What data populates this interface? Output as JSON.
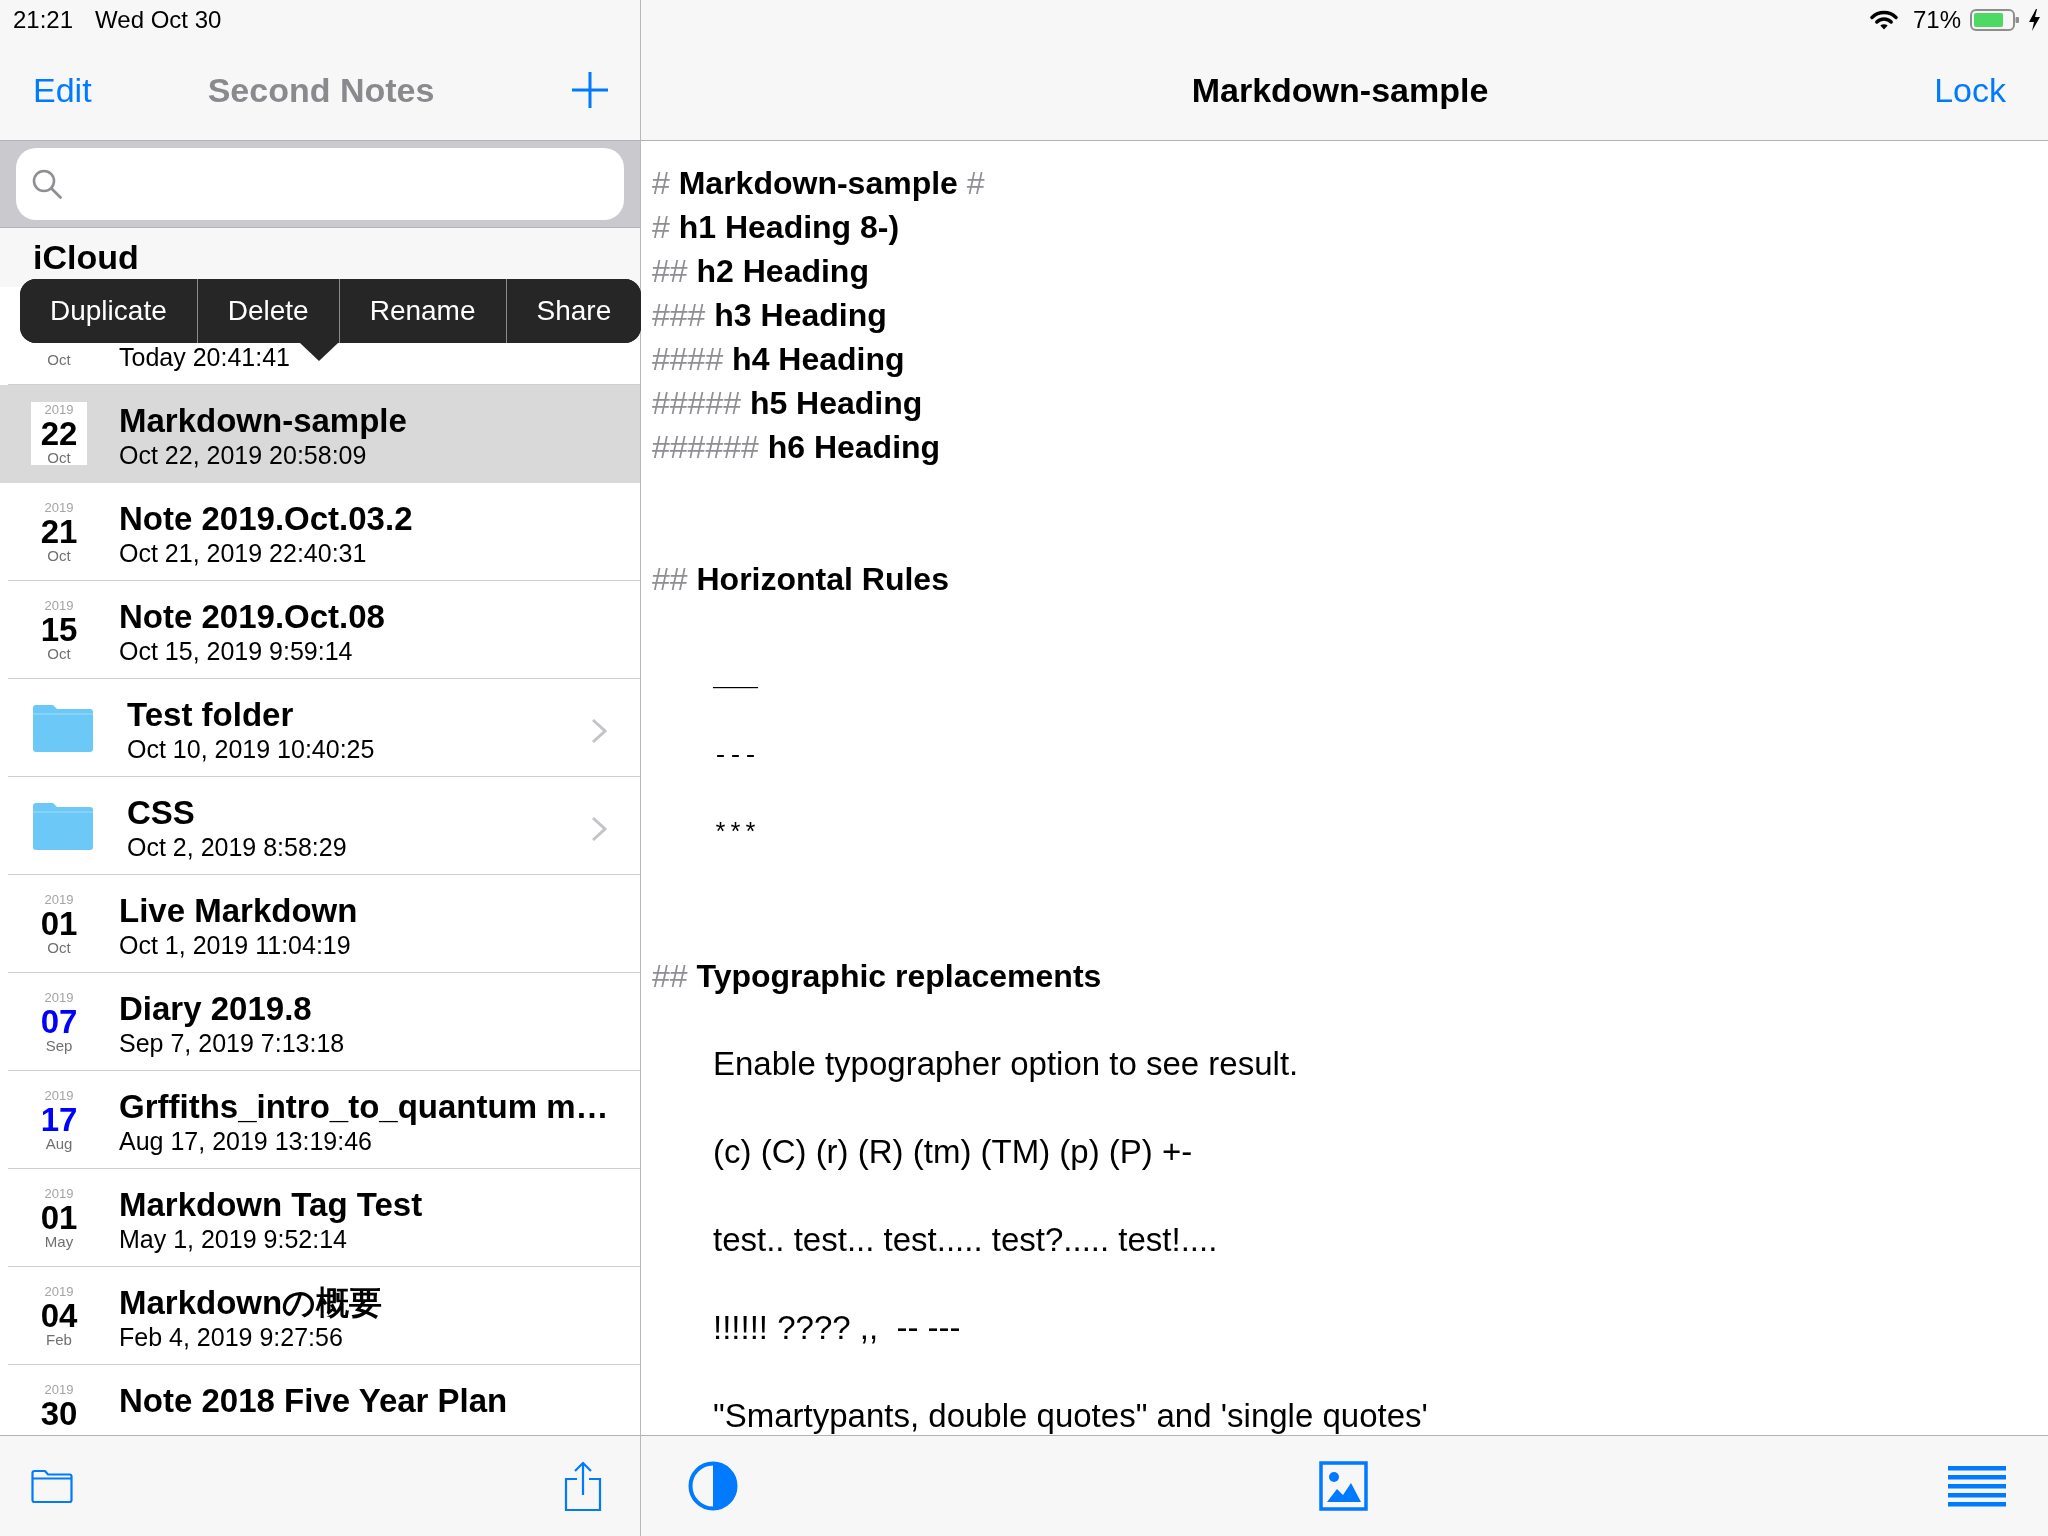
{
  "status_bar": {
    "time": "21:21",
    "date": "Wed Oct 30",
    "battery": "71%"
  },
  "sidebar": {
    "edit": "Edit",
    "title": "Second Notes",
    "section": "iCloud",
    "items": [
      {
        "kind": "note",
        "month": "Oct",
        "subtitle": "Today 20:41:41",
        "selected": false
      },
      {
        "kind": "note",
        "year": "2019",
        "day": "22",
        "month": "Oct",
        "color": "#000000",
        "title": "Markdown-sample",
        "subtitle": "Oct 22, 2019 20:58:09",
        "selected": true
      },
      {
        "kind": "note",
        "year": "2019",
        "day": "21",
        "month": "Oct",
        "color": "#000000",
        "title": "Note 2019.Oct.03.2",
        "subtitle": "Oct 21, 2019 22:40:31",
        "selected": false
      },
      {
        "kind": "note",
        "year": "2019",
        "day": "15",
        "month": "Oct",
        "color": "#000000",
        "title": "Note 2019.Oct.08",
        "subtitle": "Oct 15, 2019 9:59:14",
        "selected": false
      },
      {
        "kind": "folder",
        "title": "Test folder",
        "subtitle": "Oct 10, 2019 10:40:25",
        "selected": false
      },
      {
        "kind": "folder",
        "title": "CSS",
        "subtitle": "Oct 2, 2019 8:58:29",
        "selected": false
      },
      {
        "kind": "note",
        "year": "2019",
        "day": "01",
        "month": "Oct",
        "color": "#000000",
        "title": "Live Markdown",
        "subtitle": "Oct 1, 2019 11:04:19",
        "selected": false
      },
      {
        "kind": "note",
        "year": "2019",
        "day": "07",
        "month": "Sep",
        "color": "#0000ff",
        "title": "Diary 2019.8",
        "subtitle": "Sep 7, 2019 7:13:18",
        "selected": false
      },
      {
        "kind": "note",
        "year": "2019",
        "day": "17",
        "month": "Aug",
        "color": "#0000ff",
        "title": "Grffiths_intro_to_quantum m…",
        "subtitle": "Aug 17, 2019 13:19:46",
        "selected": false
      },
      {
        "kind": "note",
        "year": "2019",
        "day": "01",
        "month": "May",
        "color": "#000000",
        "title": "Markdown Tag Test",
        "subtitle": "May 1, 2019 9:52:14",
        "selected": false
      },
      {
        "kind": "note",
        "year": "2019",
        "day": "04",
        "month": "Feb",
        "color": "#000000",
        "title": "Markdownの概要",
        "subtitle": "Feb 4, 2019 9:27:56",
        "selected": false
      },
      {
        "kind": "note",
        "year": "2019",
        "day": "30",
        "color": "#000000",
        "title": "Note 2018 Five Year Plan",
        "selected": false
      }
    ]
  },
  "context_menu": {
    "items": [
      "Duplicate",
      "Delete",
      "Rename",
      "Share"
    ]
  },
  "editor": {
    "title": "Markdown-sample",
    "lock": "Lock",
    "lines": [
      {
        "kind": "heading",
        "marker": "#",
        "text": "Markdown-sample",
        "closing": "#"
      },
      {
        "kind": "heading",
        "marker": "#",
        "text": "h1 Heading 8-)"
      },
      {
        "kind": "heading",
        "marker": "##",
        "text": "h2 Heading"
      },
      {
        "kind": "heading",
        "marker": "###",
        "text": "h3 Heading"
      },
      {
        "kind": "heading",
        "marker": "####",
        "text": "h4 Heading"
      },
      {
        "kind": "heading",
        "marker": "#####",
        "text": "h5 Heading"
      },
      {
        "kind": "heading",
        "marker": "######",
        "text": "h6 Heading"
      },
      {
        "kind": "section",
        "marker": "##",
        "text": "Horizontal Rules"
      },
      {
        "kind": "rule",
        "text": "___"
      },
      {
        "kind": "rule",
        "text": "---"
      },
      {
        "kind": "rule",
        "text": "***"
      },
      {
        "kind": "section",
        "marker": "##",
        "text": "Typographic replacements"
      },
      {
        "kind": "text",
        "text": "Enable typographer option to see result."
      },
      {
        "kind": "text",
        "text": "(c) (C) (r) (R) (tm) (TM) (p) (P) +-"
      },
      {
        "kind": "text",
        "text": "test.. test... test..... test?..... test!...."
      },
      {
        "kind": "text",
        "text": "!!!!!! ???? ,,  -- ---"
      },
      {
        "kind": "text",
        "text": "\"Smartypants, double quotes\" and 'single quotes'"
      }
    ]
  }
}
